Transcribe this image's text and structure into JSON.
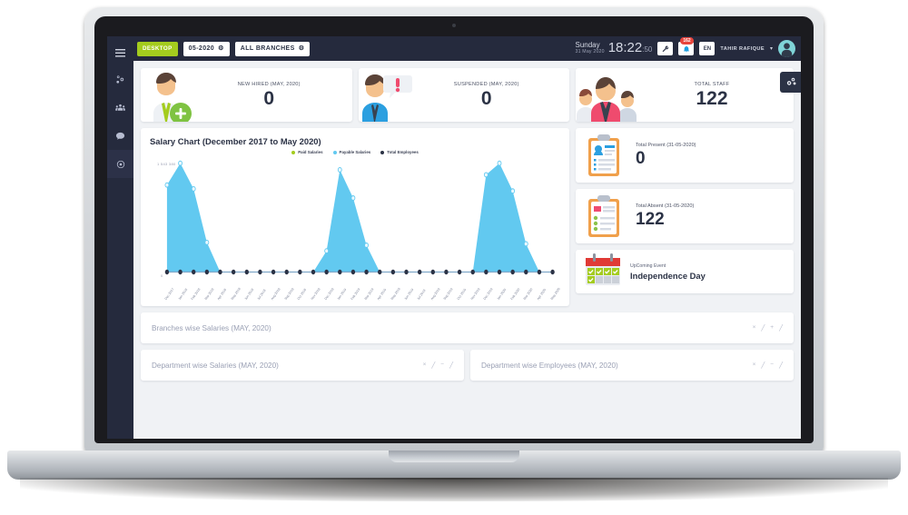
{
  "sidebar": {
    "burger_icon": "hamburger-menu-icon",
    "items": [
      {
        "icon": "gears-icon",
        "name": "settings",
        "active": false
      },
      {
        "icon": "users-group-icon",
        "name": "employees",
        "active": false
      },
      {
        "icon": "chat-bubble-icon",
        "name": "messages",
        "active": false
      },
      {
        "icon": "clock-circle-icon",
        "name": "attendance",
        "active": true
      }
    ]
  },
  "topbar": {
    "desktop_label": "DESKTOP",
    "period_label": "05-2020",
    "branch_label": "ALL BRANCHES",
    "gear_glyph": "⚙",
    "day": "Sunday",
    "date": "31 May 2020",
    "time": "18:22",
    "seconds": ":50",
    "tools_icon": "wrench-icon",
    "bell_icon": "bell-icon",
    "notification_count": "162",
    "language": "EN",
    "username": "TAHIR RAFIQUE",
    "caret_glyph": "▾",
    "avatar_icon": "user-avatar-icon"
  },
  "stats": [
    {
      "label": "NEW HIRED (MAY, 2020)",
      "value": "0",
      "icon": "new-hire-person-icon"
    },
    {
      "label": "SUSPENDED (MAY, 2020)",
      "value": "0",
      "icon": "suspended-person-icon"
    },
    {
      "label": "TOTAL STAFF",
      "value": "122",
      "icon": "staff-group-icon"
    }
  ],
  "gears_tab_icon": "gears-settings-icon",
  "side_cards": [
    {
      "label": "Total Present (31-05-2020)",
      "value": "0",
      "icon": "clipboard-present-icon"
    },
    {
      "label": "Total Absent (31-05-2020)",
      "value": "122",
      "icon": "clipboard-absent-icon"
    }
  ],
  "event": {
    "label": "UpComing Event",
    "name": "Independence Day",
    "icon": "calendar-icon"
  },
  "panels": [
    {
      "title": "Branches wise Salaries (MAY, 2020)",
      "actions": [
        "×",
        "╱",
        "+",
        "╱"
      ]
    },
    {
      "title": "Department wise Salaries (MAY, 2020)",
      "actions": [
        "×",
        "╱",
        "−",
        "╱"
      ]
    },
    {
      "title": "Department wise Employees (MAY, 2020)",
      "actions": [
        "×",
        "╱",
        "−",
        "╱"
      ]
    }
  ],
  "colors": {
    "sidebar": "#252a3d",
    "accent_green": "#a4cc1e",
    "chart_blue": "#62c9f0",
    "chart_dark": "#2b3245",
    "badge_red": "#e8453c"
  },
  "chart_data": {
    "type": "area",
    "title": "Salary Chart (December 2017 to May 2020)",
    "xlabel": "",
    "ylabel": "",
    "ymax_label": "1 543 380",
    "ymin_label": "0",
    "ylim": [
      0,
      1543380
    ],
    "grid": false,
    "legend_position": "top-center",
    "legend": [
      {
        "name": "Paid Salaries",
        "color": "#a4cc1e"
      },
      {
        "name": "Payable Salaries",
        "color": "#62c9f0"
      },
      {
        "name": "Total Employees",
        "color": "#2b3245"
      }
    ],
    "categories": [
      "Dec 2017",
      "Jan 2018",
      "Feb 2018",
      "Mar 2018",
      "Apr 2018",
      "May 2018",
      "Jun 2018",
      "Jul 2018",
      "Aug 2018",
      "Sep 2018",
      "Oct 2018",
      "Nov 2018",
      "Dec 2018",
      "Jan 2019",
      "Feb 2019",
      "Mar 2019",
      "Apr 2019",
      "May 2019",
      "Jun 2019",
      "Jul 2019",
      "Aug 2019",
      "Sep 2019",
      "Oct 2019",
      "Nov 2019",
      "Dec 2019",
      "Jan 2020",
      "Feb 2020",
      "Mar 2020",
      "Apr 2020",
      "May 2020"
    ],
    "series": [
      {
        "name": "Payable Salaries",
        "color": "#62c9f0",
        "values": [
          1235000,
          1543380,
          1180000,
          420000,
          0,
          0,
          0,
          0,
          0,
          0,
          0,
          0,
          300000,
          1450000,
          1050000,
          380000,
          0,
          0,
          0,
          0,
          0,
          0,
          0,
          0,
          1380000,
          1543380,
          1150000,
          400000,
          0,
          0
        ]
      },
      {
        "name": "Paid Salaries",
        "color": "#a4cc1e",
        "values": [
          0,
          0,
          0,
          0,
          0,
          0,
          0,
          0,
          0,
          0,
          0,
          0,
          0,
          0,
          0,
          0,
          0,
          0,
          0,
          0,
          0,
          0,
          0,
          0,
          0,
          0,
          0,
          0,
          0,
          0
        ]
      },
      {
        "name": "Total Employees",
        "color": "#2b3245",
        "values": [
          0,
          0,
          0,
          0,
          0,
          0,
          0,
          0,
          0,
          0,
          0,
          0,
          0,
          0,
          0,
          0,
          0,
          0,
          0,
          0,
          0,
          0,
          0,
          0,
          0,
          0,
          0,
          0,
          0,
          0
        ]
      }
    ]
  }
}
